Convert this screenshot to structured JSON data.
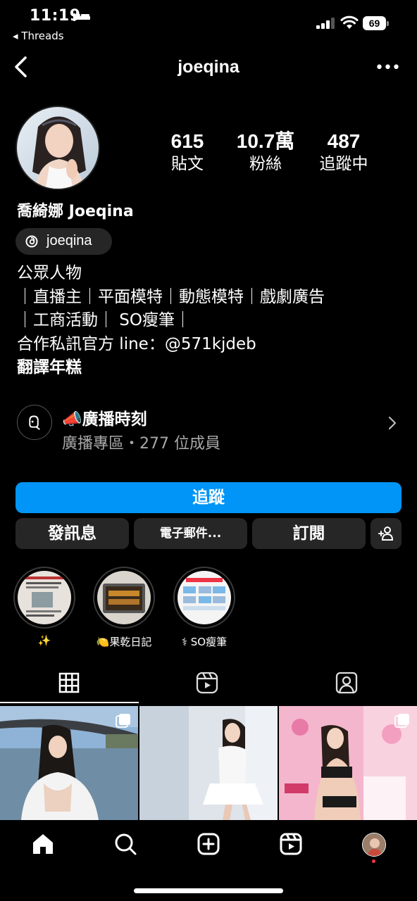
{
  "status_bar": {
    "time": "11:19",
    "back_app": "◂ Threads",
    "battery": "69",
    "icons": [
      "bed-icon",
      "signal-icon",
      "wifi-icon",
      "battery-icon"
    ]
  },
  "header": {
    "username": "joeqina",
    "back_icon": "chevron-left-icon",
    "more_icon": "more-horizontal-icon",
    "more_label": "•••"
  },
  "stats": [
    {
      "value": "615",
      "label": "貼文"
    },
    {
      "value": "10.7萬",
      "label": "粉絲"
    },
    {
      "value": "487",
      "label": "追蹤中"
    }
  ],
  "profile": {
    "display_name": "喬綺娜 Joeqina",
    "threads_handle": "joeqina",
    "bio_lines": [
      "公眾人物",
      "｜直播主｜平面模特｜動態模特｜戲劇廣告",
      "｜工商活動｜ SO瘦筆｜",
      "合作私訊官方 line：@571kjdeb",
      "翻譯年糕"
    ]
  },
  "channel": {
    "title": "📣廣播時刻",
    "subtitle": "廣播專區・277 位成員"
  },
  "buttons": {
    "follow": "追蹤",
    "message": "發訊息",
    "email": "電子郵件...",
    "subscribe": "訂閱"
  },
  "highlights": [
    {
      "caption": "✨"
    },
    {
      "caption": "🍋果乾日記"
    },
    {
      "caption": "⚕ SO瘦筆"
    }
  ],
  "tabs": [
    {
      "icon": "grid-icon",
      "active": true
    },
    {
      "icon": "reels-icon",
      "active": false
    },
    {
      "icon": "tagged-icon",
      "active": false
    }
  ],
  "bottom_nav": [
    {
      "icon": "home-icon"
    },
    {
      "icon": "search-icon"
    },
    {
      "icon": "create-icon"
    },
    {
      "icon": "reels-icon"
    },
    {
      "icon": "profile-avatar"
    }
  ],
  "colors": {
    "background": "#000000",
    "accent": "#0095f6",
    "button_gray": "#262626",
    "notification_dot": "#ff3040"
  }
}
